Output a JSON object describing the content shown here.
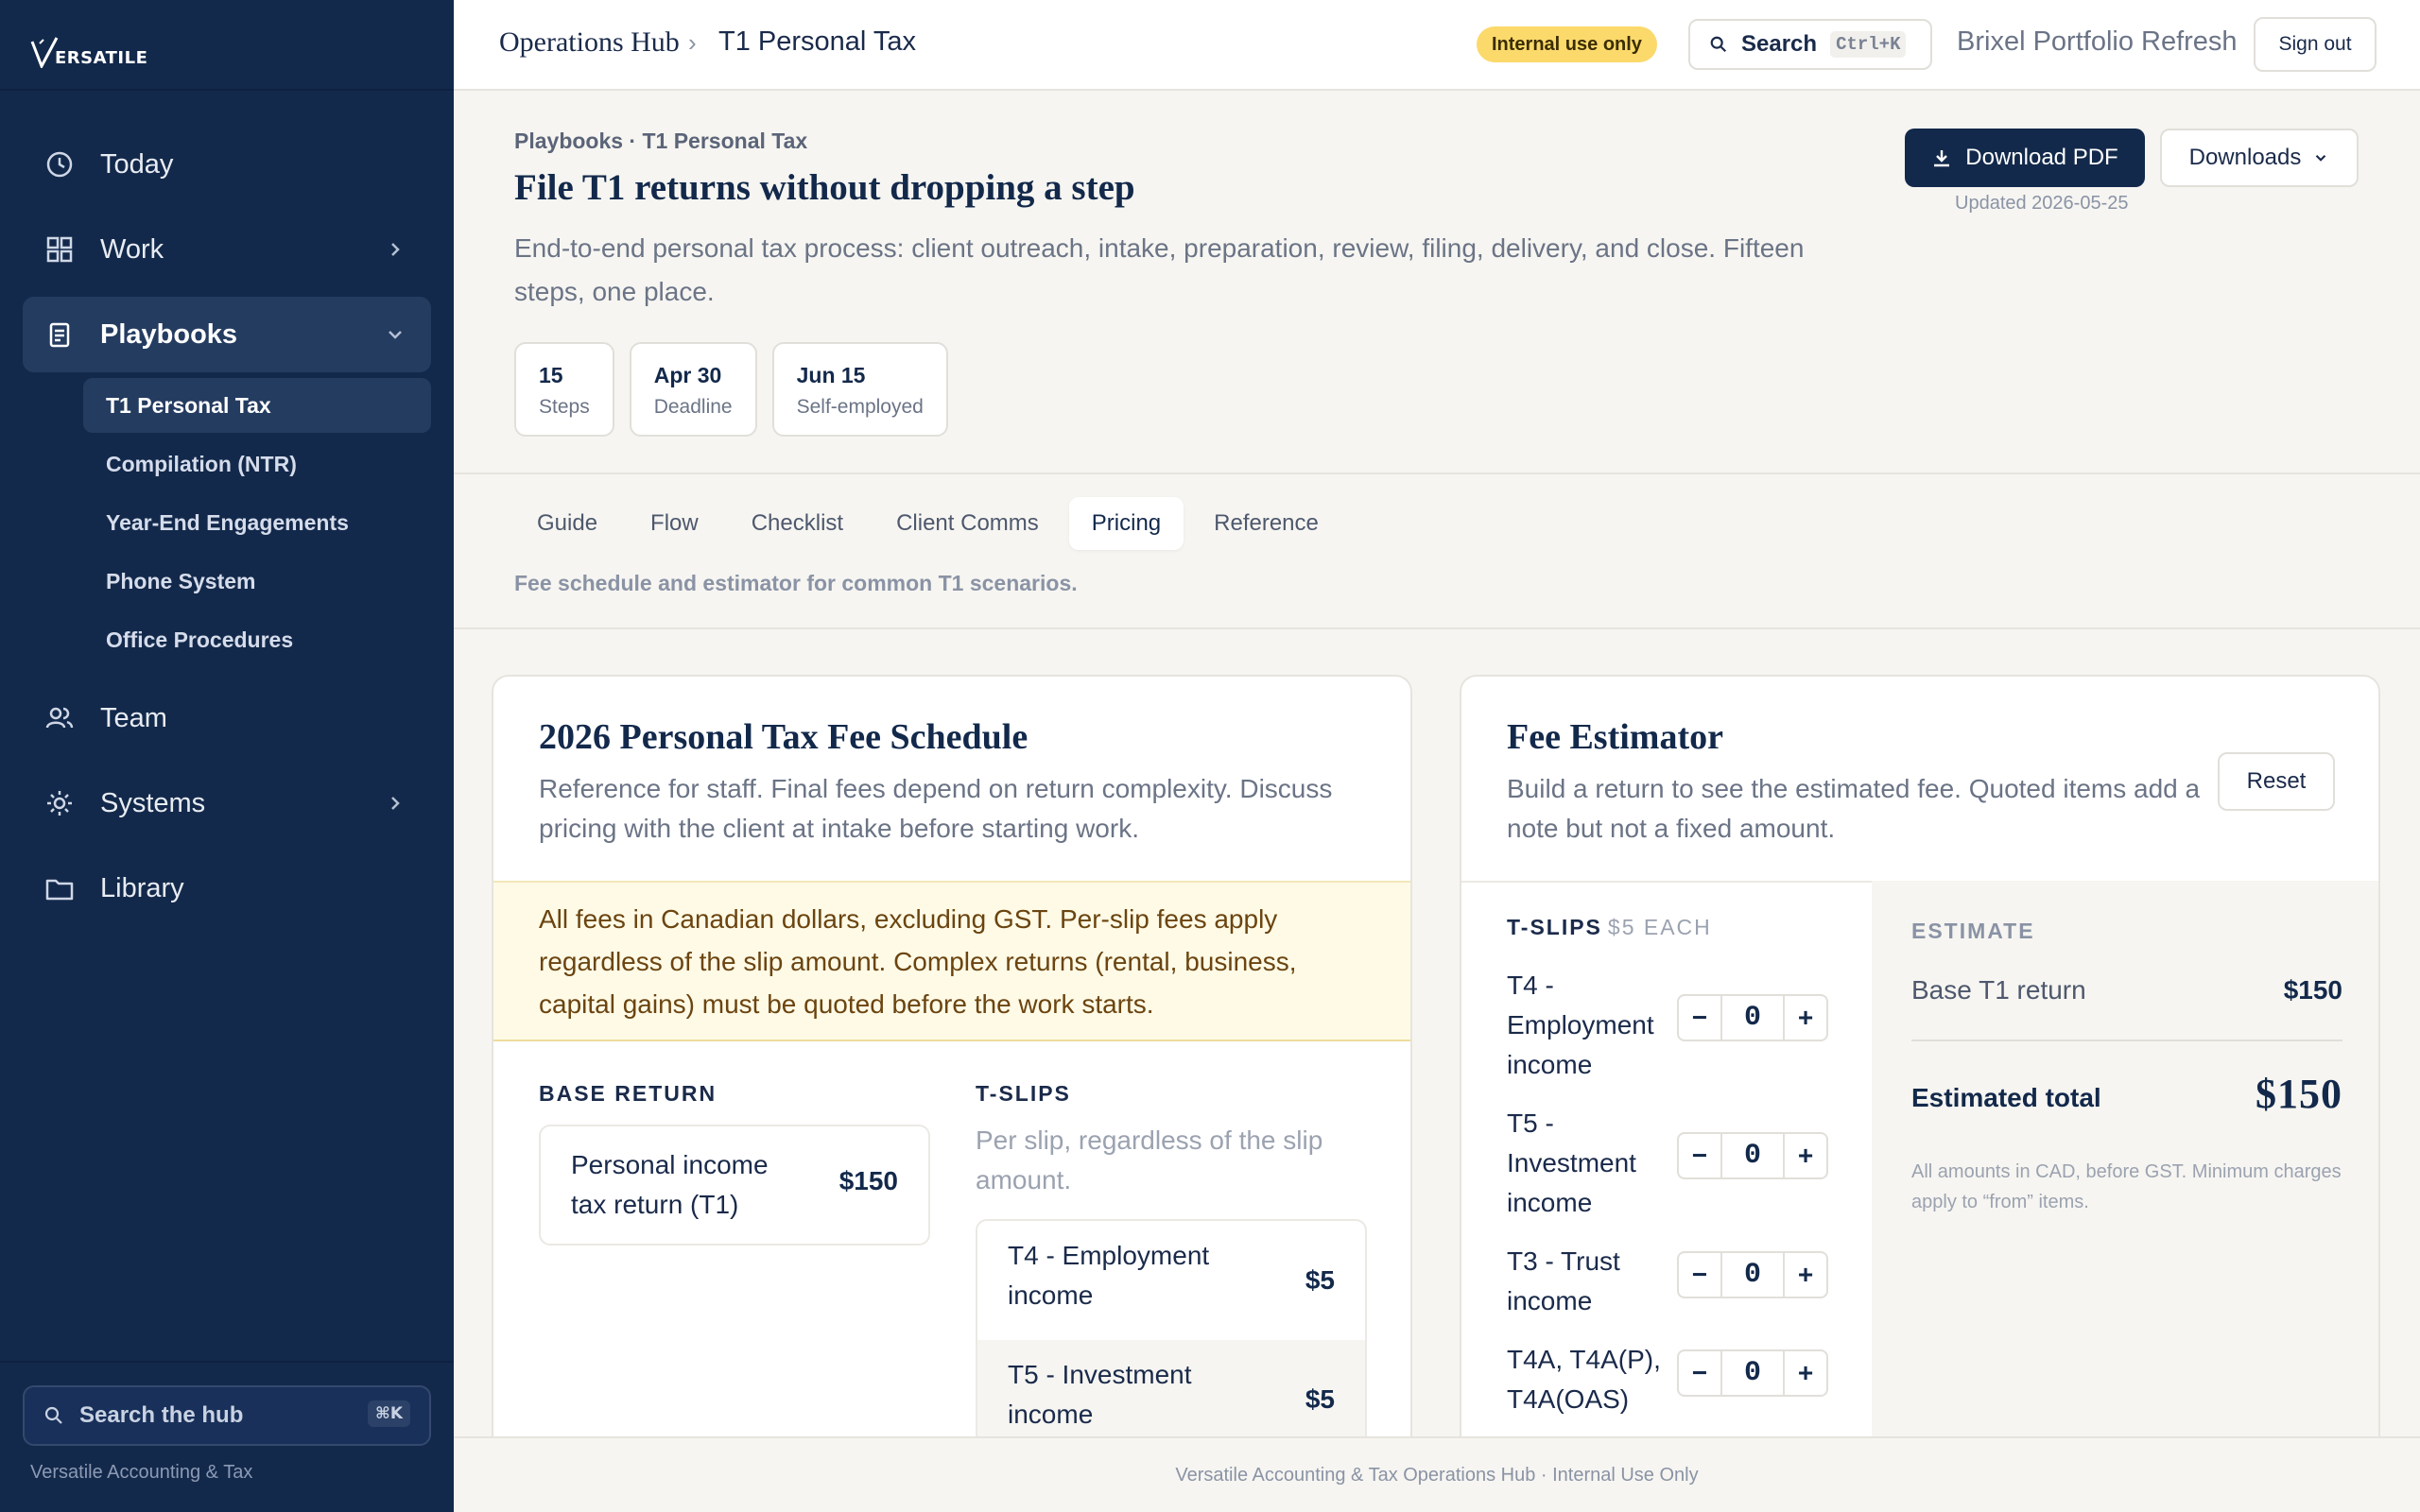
{
  "sidebar": {
    "brand": "ERSATILE",
    "nav": [
      {
        "label": "Today"
      },
      {
        "label": "Work"
      },
      {
        "label": "Playbooks"
      },
      {
        "label": "Team"
      },
      {
        "label": "Systems"
      },
      {
        "label": "Library"
      }
    ],
    "playbooks": [
      {
        "label": "T1 Personal Tax"
      },
      {
        "label": "Compilation (NTR)"
      },
      {
        "label": "Year-End Engagements"
      },
      {
        "label": "Phone System"
      },
      {
        "label": "Office Procedures"
      }
    ],
    "search_label": "Search the hub",
    "search_kbd": "⌘K",
    "footer": "Versatile Accounting & Tax"
  },
  "topbar": {
    "crumb_root": "Operations Hub",
    "crumb_sep": "›",
    "crumb_current": "T1 Personal Tax",
    "badge": "Internal use only",
    "search_label": "Search",
    "search_kbd": "Ctrl+K",
    "project": "Brixel Portfolio Refresh",
    "signout": "Sign out"
  },
  "header": {
    "eyebrow": "Playbooks · T1 Personal Tax",
    "title": "File T1 returns without dropping a step",
    "description": "End-to-end personal tax process: client outreach, intake, preparation, review, filing, delivery, and close. Fifteen steps, one place.",
    "stats": [
      {
        "value": "15",
        "label": "Steps"
      },
      {
        "value": "Apr 30",
        "label": "Deadline"
      },
      {
        "value": "Jun 15",
        "label": "Self-employed"
      }
    ],
    "download_pdf": "Download PDF",
    "downloads": "Downloads",
    "updated": "Updated 2026-05-25"
  },
  "tabs": {
    "items": [
      {
        "label": "Guide"
      },
      {
        "label": "Flow"
      },
      {
        "label": "Checklist"
      },
      {
        "label": "Client Comms"
      },
      {
        "label": "Pricing"
      },
      {
        "label": "Reference"
      }
    ],
    "active": "Pricing",
    "caption": "Fee schedule and estimator for common T1 scenarios."
  },
  "schedule": {
    "title": "2026 Personal Tax Fee Schedule",
    "subtitle": "Reference for staff. Final fees depend on return complexity. Discuss pricing with the client at intake before starting work.",
    "notice": "All fees in Canadian dollars, excluding GST. Per-slip fees apply regardless of the slip amount. Complex returns (rental, business, capital gains) must be quoted before the work starts.",
    "base_label": "BASE RETURN",
    "base_name": "Personal income tax return (T1)",
    "base_price": "$150",
    "tslips_label": "T-SLIPS",
    "tslips_sub": "Per slip, regardless of the slip amount.",
    "slips": [
      {
        "name": "T4 - Employment income",
        "price": "$5"
      },
      {
        "name": "T5 - Investment income",
        "price": "$5"
      }
    ]
  },
  "estimator": {
    "title": "Fee Estimator",
    "subtitle": "Build a return to see the estimated fee. Quoted items add a note but not a fixed amount.",
    "reset": "Reset",
    "tslips_label": "T-SLIPS",
    "tslips_each": "$5 EACH",
    "rows": [
      {
        "name": "T4 - Employment income",
        "count": "0"
      },
      {
        "name": "T5 - Investment income",
        "count": "0"
      },
      {
        "name": "T3 - Trust income",
        "count": "0"
      },
      {
        "name": "T4A, T4A(P), T4A(OAS)",
        "count": "0"
      }
    ],
    "minus": "−",
    "plus": "+",
    "estimate_label": "ESTIMATE",
    "base_line": "Base T1 return",
    "base_price": "$150",
    "total_label": "Estimated total",
    "total_value": "$150",
    "note": "All amounts in CAD, before GST. Minimum charges apply to “from” items."
  },
  "footer": "Versatile Accounting & Tax Operations Hub · Internal Use Only",
  "colors": {
    "navy": "#13294b",
    "badge": "#fbd96b",
    "notice_bg": "#fefae6"
  }
}
